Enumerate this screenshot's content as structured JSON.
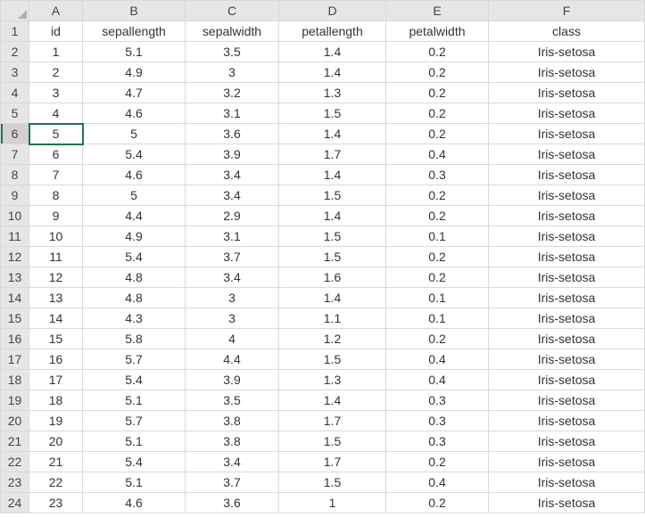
{
  "columns": [
    "A",
    "B",
    "C",
    "D",
    "E",
    "F"
  ],
  "row_numbers": [
    1,
    2,
    3,
    4,
    5,
    6,
    7,
    8,
    9,
    10,
    11,
    12,
    13,
    14,
    15,
    16,
    17,
    18,
    19,
    20,
    21,
    22,
    23,
    24
  ],
  "selected_row_header": 6,
  "selected_cell": {
    "row": 6,
    "col": "A"
  },
  "headers": {
    "A": "id",
    "B": "sepallength",
    "C": "sepalwidth",
    "D": "petallength",
    "E": "petalwidth",
    "F": "class"
  },
  "rows": [
    {
      "id": "1",
      "sepallength": "5.1",
      "sepalwidth": "3.5",
      "petallength": "1.4",
      "petalwidth": "0.2",
      "class": "Iris-setosa"
    },
    {
      "id": "2",
      "sepallength": "4.9",
      "sepalwidth": "3",
      "petallength": "1.4",
      "petalwidth": "0.2",
      "class": "Iris-setosa"
    },
    {
      "id": "3",
      "sepallength": "4.7",
      "sepalwidth": "3.2",
      "petallength": "1.3",
      "petalwidth": "0.2",
      "class": "Iris-setosa"
    },
    {
      "id": "4",
      "sepallength": "4.6",
      "sepalwidth": "3.1",
      "petallength": "1.5",
      "petalwidth": "0.2",
      "class": "Iris-setosa"
    },
    {
      "id": "5",
      "sepallength": "5",
      "sepalwidth": "3.6",
      "petallength": "1.4",
      "petalwidth": "0.2",
      "class": "Iris-setosa"
    },
    {
      "id": "6",
      "sepallength": "5.4",
      "sepalwidth": "3.9",
      "petallength": "1.7",
      "petalwidth": "0.4",
      "class": "Iris-setosa"
    },
    {
      "id": "7",
      "sepallength": "4.6",
      "sepalwidth": "3.4",
      "petallength": "1.4",
      "petalwidth": "0.3",
      "class": "Iris-setosa"
    },
    {
      "id": "8",
      "sepallength": "5",
      "sepalwidth": "3.4",
      "petallength": "1.5",
      "petalwidth": "0.2",
      "class": "Iris-setosa"
    },
    {
      "id": "9",
      "sepallength": "4.4",
      "sepalwidth": "2.9",
      "petallength": "1.4",
      "petalwidth": "0.2",
      "class": "Iris-setosa"
    },
    {
      "id": "10",
      "sepallength": "4.9",
      "sepalwidth": "3.1",
      "petallength": "1.5",
      "petalwidth": "0.1",
      "class": "Iris-setosa"
    },
    {
      "id": "11",
      "sepallength": "5.4",
      "sepalwidth": "3.7",
      "petallength": "1.5",
      "petalwidth": "0.2",
      "class": "Iris-setosa"
    },
    {
      "id": "12",
      "sepallength": "4.8",
      "sepalwidth": "3.4",
      "petallength": "1.6",
      "petalwidth": "0.2",
      "class": "Iris-setosa"
    },
    {
      "id": "13",
      "sepallength": "4.8",
      "sepalwidth": "3",
      "petallength": "1.4",
      "petalwidth": "0.1",
      "class": "Iris-setosa"
    },
    {
      "id": "14",
      "sepallength": "4.3",
      "sepalwidth": "3",
      "petallength": "1.1",
      "petalwidth": "0.1",
      "class": "Iris-setosa"
    },
    {
      "id": "15",
      "sepallength": "5.8",
      "sepalwidth": "4",
      "petallength": "1.2",
      "petalwidth": "0.2",
      "class": "Iris-setosa"
    },
    {
      "id": "16",
      "sepallength": "5.7",
      "sepalwidth": "4.4",
      "petallength": "1.5",
      "petalwidth": "0.4",
      "class": "Iris-setosa"
    },
    {
      "id": "17",
      "sepallength": "5.4",
      "sepalwidth": "3.9",
      "petallength": "1.3",
      "petalwidth": "0.4",
      "class": "Iris-setosa"
    },
    {
      "id": "18",
      "sepallength": "5.1",
      "sepalwidth": "3.5",
      "petallength": "1.4",
      "petalwidth": "0.3",
      "class": "Iris-setosa"
    },
    {
      "id": "19",
      "sepallength": "5.7",
      "sepalwidth": "3.8",
      "petallength": "1.7",
      "petalwidth": "0.3",
      "class": "Iris-setosa"
    },
    {
      "id": "20",
      "sepallength": "5.1",
      "sepalwidth": "3.8",
      "petallength": "1.5",
      "petalwidth": "0.3",
      "class": "Iris-setosa"
    },
    {
      "id": "21",
      "sepallength": "5.4",
      "sepalwidth": "3.4",
      "petallength": "1.7",
      "petalwidth": "0.2",
      "class": "Iris-setosa"
    },
    {
      "id": "22",
      "sepallength": "5.1",
      "sepalwidth": "3.7",
      "petallength": "1.5",
      "petalwidth": "0.4",
      "class": "Iris-setosa"
    },
    {
      "id": "23",
      "sepallength": "4.6",
      "sepalwidth": "3.6",
      "petallength": "1",
      "petalwidth": "0.2",
      "class": "Iris-setosa"
    }
  ]
}
